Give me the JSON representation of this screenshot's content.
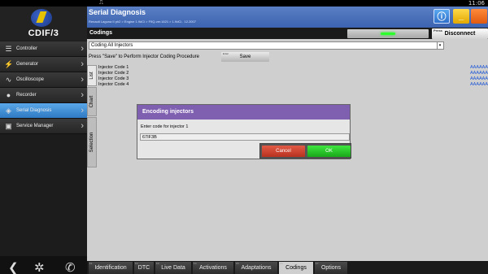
{
  "status": {
    "clock": "11:06",
    "usb_icon": "usb-icon"
  },
  "app": {
    "name": "CDIF/3"
  },
  "sidebar": {
    "items": [
      {
        "label": "Controller",
        "icon": "sliders-icon"
      },
      {
        "label": "Generator",
        "icon": "generator-icon"
      },
      {
        "label": "Oscilloscope",
        "icon": "wave-icon"
      },
      {
        "label": "Recorder",
        "icon": "record-icon"
      },
      {
        "label": "Serial Diagnosis",
        "icon": "diagnosis-icon",
        "active": true
      },
      {
        "label": "Service Manager",
        "icon": "service-icon"
      }
    ],
    "bottom": [
      "back-icon",
      "settings-icon",
      "phone-icon"
    ]
  },
  "header": {
    "title": "Serial Diagnosis",
    "subtitle": "Renault Laguna II ph2 > Engine 1.9dCi > F9Q-ver.1621 > 1.9dCi.. 12.2007"
  },
  "codings_bar": {
    "title": "Codings",
    "disconnect_small": "Press",
    "disconnect_label": "Disconnect"
  },
  "content": {
    "select_value": "Coding All Injectors",
    "instruction": "Press \"Save\" to Perform Injector Coding Procedure",
    "save_small": "Enter",
    "save_label": "Save",
    "side_tabs": [
      "List",
      "Chart",
      "Selection"
    ],
    "codes": [
      {
        "label": "Injector Code 1",
        "value": "AAAAAA"
      },
      {
        "label": "Injector Code 2",
        "value": "AAAAAA"
      },
      {
        "label": "Injector Code 3",
        "value": "AAAAAA"
      },
      {
        "label": "Injector Code 4",
        "value": "AAAAAA"
      }
    ]
  },
  "dialog": {
    "title": "Encoding injectors",
    "prompt": "Enter code for injector 1",
    "input_value": "67IF3B",
    "cancel_label": "Cancel",
    "ok_label": "OK"
  },
  "tabs": [
    {
      "label": "Identification",
      "small": "F1"
    },
    {
      "label": "DTC",
      "small": "F2"
    },
    {
      "label": "Live Data",
      "small": "F3"
    },
    {
      "label": "Activations",
      "small": "F4"
    },
    {
      "label": "Adaptations",
      "small": "F5"
    },
    {
      "label": "Codings",
      "small": "F6",
      "active": true
    },
    {
      "label": "Options",
      "small": "F7"
    }
  ]
}
